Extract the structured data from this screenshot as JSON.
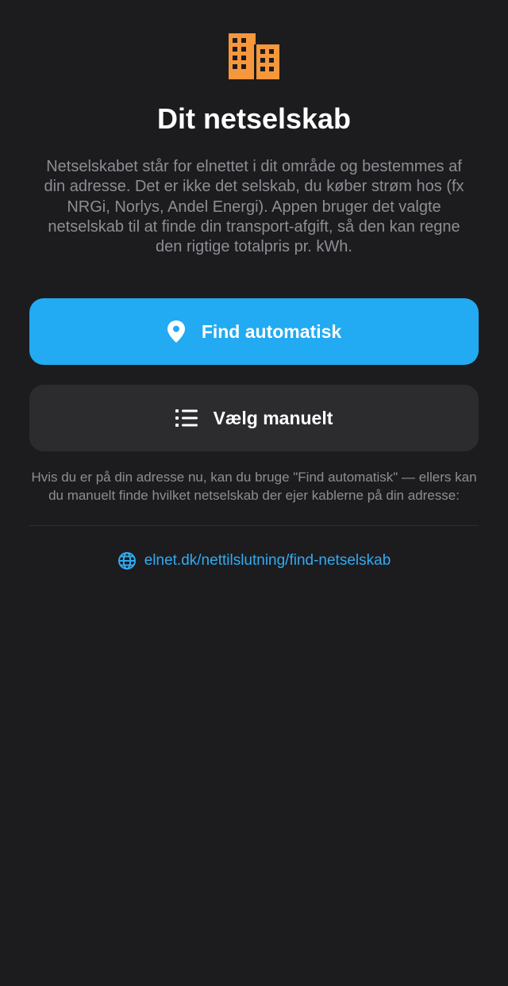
{
  "colors": {
    "background": "#1c1c1f",
    "accent_orange": "#f7973c",
    "primary_button": "#22aaf2",
    "secondary_button": "#2c2c2f",
    "link": "#33aaf0",
    "muted_text": "#8d8d93"
  },
  "header": {
    "logo_icon": "building-icon",
    "title": "Dit netselskab",
    "description": "Netselskabet står for elnettet i dit område og bestemmes af din adresse. Det er ikke det selskab, du køber strøm hos (fx NRGi, Norlys, Andel Energi). Appen bruger det valgte netselskab til at finde din transport-afgift, så den kan regne den rigtige totalpris pr. kWh."
  },
  "actions": {
    "find_auto": {
      "icon": "location-pin-icon",
      "label": "Find automatisk"
    },
    "choose_manual": {
      "icon": "list-icon",
      "label": "Vælg manuelt"
    }
  },
  "hint": "Hvis du er på din adresse nu, kan du bruge \"Find automatisk\" — ellers kan du manuelt finde hvilket netselskab der ejer kablerne på din adresse:",
  "link": {
    "icon": "globe-icon",
    "text": "elnet.dk/nettilslutning/find-netselskab"
  }
}
